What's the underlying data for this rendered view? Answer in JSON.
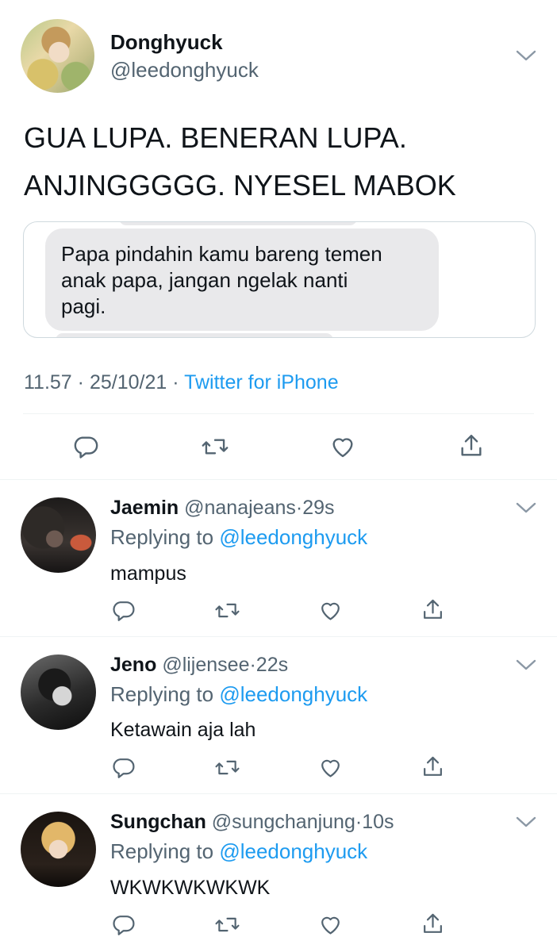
{
  "tweet": {
    "author_name": "Donghyuck",
    "author_handle": "@leedonghyuck",
    "text_line1": "GUA LUPA. BENERAN LUPA.",
    "text_line2": "ANJINGGGGG. NYESEL MABOK",
    "media": {
      "message_line1": "Papa pindahin kamu bareng temen",
      "message_line2": "anak papa, jangan ngelak nanti",
      "message_line3": "pagi."
    },
    "time": "11.57",
    "date": "25/10/21",
    "separator": "·",
    "source": "Twitter for iPhone"
  },
  "replies": [
    {
      "name": "Jaemin",
      "handle": "@nanajeans",
      "time": "29s",
      "replying_prefix": "Replying to",
      "replying_to": "@leedonghyuck",
      "text": "mampus"
    },
    {
      "name": "Jeno",
      "handle": "@lijensee",
      "time": "22s",
      "replying_prefix": "Replying to",
      "replying_to": "@leedonghyuck",
      "text": "Ketawain aja lah"
    },
    {
      "name": "Sungchan",
      "handle": "@sungchanjung",
      "time": "10s",
      "replying_prefix": "Replying to",
      "replying_to": "@leedonghyuck",
      "text": "WKWKWKWKWK"
    }
  ],
  "icons": {
    "more": "chevron-down-icon",
    "reply": "reply-icon",
    "retweet": "retweet-icon",
    "like": "heart-icon",
    "share": "share-icon"
  },
  "colors": {
    "link": "#1d9bf0",
    "muted": "#536471",
    "text": "#0f1419",
    "bubble": "#e9e9eb",
    "divider": "#eff3f4"
  }
}
